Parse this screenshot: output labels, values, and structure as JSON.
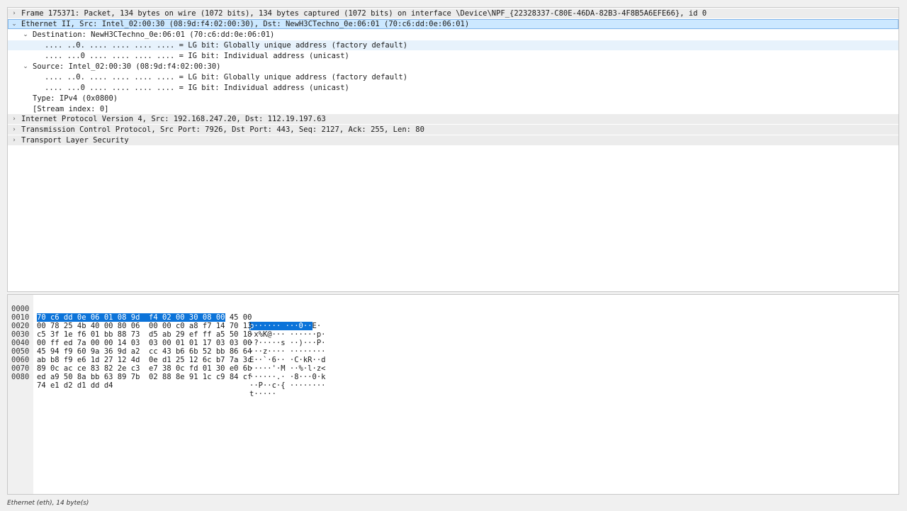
{
  "tree": [
    {
      "text": "Frame 175371: Packet, 134 bytes on wire (1072 bits), 134 bytes captured (1072 bits) on interface \\Device\\NPF_{22328337-C80E-46DA-82B3-4F8B5A6EFE66}, id 0",
      "arrow": "›"
    },
    {
      "text": "Ethernet II, Src: Intel_02:00:30 (08:9d:f4:02:00:30), Dst: NewH3CTechno_0e:06:01 (70:c6:dd:0e:06:01)",
      "arrow": "⌄"
    },
    {
      "text": "Destination: NewH3CTechno_0e:06:01 (70:c6:dd:0e:06:01)",
      "arrow": "⌄"
    },
    {
      "text": ".... ..0. .... .... .... .... = LG bit: Globally unique address (factory default)",
      "arrow": ""
    },
    {
      "text": ".... ...0 .... .... .... .... = IG bit: Individual address (unicast)",
      "arrow": ""
    },
    {
      "text": "Source: Intel_02:00:30 (08:9d:f4:02:00:30)",
      "arrow": "⌄"
    },
    {
      "text": ".... ..0. .... .... .... .... = LG bit: Globally unique address (factory default)",
      "arrow": ""
    },
    {
      "text": ".... ...0 .... .... .... .... = IG bit: Individual address (unicast)",
      "arrow": ""
    },
    {
      "text": "Type: IPv4 (0x0800)",
      "arrow": ""
    },
    {
      "text": "[Stream index: 0]",
      "arrow": ""
    },
    {
      "text": "Internet Protocol Version 4, Src: 192.168.247.20, Dst: 112.19.197.63",
      "arrow": "›"
    },
    {
      "text": "Transmission Control Protocol, Src Port: 7926, Dst Port: 443, Seq: 2127, Ack: 255, Len: 80",
      "arrow": "›"
    },
    {
      "text": "Transport Layer Security",
      "arrow": "›"
    }
  ],
  "bytes": [
    {
      "offset": "0000",
      "hex_hl": "70 c6 dd 0e 06 01 08 9d  f4 02 00 30 08 00",
      "hex_rest": " 45 00",
      "ascii_hl": "p······ ···0··",
      "ascii_rest": "E·"
    },
    {
      "offset": "0010",
      "hex_hl": "",
      "hex_rest": "00 78 25 4b 40 00 80 06  00 00 c0 a8 f7 14 70 13",
      "ascii_hl": "",
      "ascii_rest": "·x%K@··· ······p·"
    },
    {
      "offset": "0020",
      "hex_hl": "",
      "hex_rest": "c5 3f 1e f6 01 bb 88 73  d5 ab 29 ef ff a5 50 18",
      "ascii_hl": "",
      "ascii_rest": "·?·····s ··)···P·"
    },
    {
      "offset": "0030",
      "hex_hl": "",
      "hex_rest": "00 ff ed 7a 00 00 14 03  03 00 01 01 17 03 03 00",
      "ascii_hl": "",
      "ascii_rest": "···z···· ········"
    },
    {
      "offset": "0040",
      "hex_hl": "",
      "hex_rest": "45 94 f9 60 9a 36 9d a2  cc 43 b6 6b 52 bb 86 64",
      "ascii_hl": "",
      "ascii_rest": "E··`·6·· ·C·kR··d"
    },
    {
      "offset": "0050",
      "hex_hl": "",
      "hex_rest": "ab b8 f9 e6 1d 27 12 4d  0e d1 25 12 6c b7 7a 3c",
      "ascii_hl": "",
      "ascii_rest": "·····'·M ··%·l·z<"
    },
    {
      "offset": "0060",
      "hex_hl": "",
      "hex_rest": "89 0c ac ce 83 82 2e c3  e7 38 0c fd 01 30 e0 6b",
      "ascii_hl": "",
      "ascii_rest": "······.· ·8···0·k"
    },
    {
      "offset": "0070",
      "hex_hl": "",
      "hex_rest": "ed a9 50 8a bb 63 89 7b  02 88 8e 91 1c c9 84 cf",
      "ascii_hl": "",
      "ascii_rest": "··P··c·{ ········"
    },
    {
      "offset": "0080",
      "hex_hl": "",
      "hex_rest": "74 e1 d2 d1 dd d4",
      "ascii_hl": "",
      "ascii_rest": "t·····"
    }
  ],
  "status": {
    "text": "Ethernet (eth), 14 byte(s)"
  },
  "colors": {
    "selection": "#cce8ff",
    "byte_highlight": "#0b73d9"
  }
}
